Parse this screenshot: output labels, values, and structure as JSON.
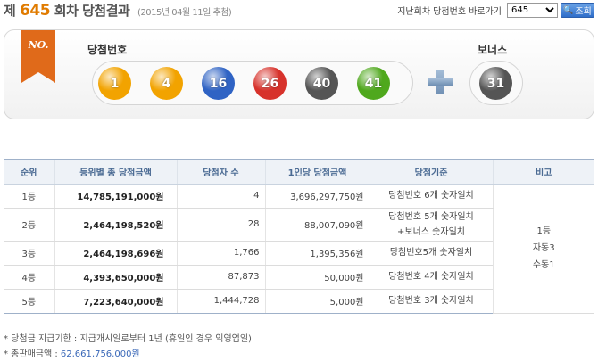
{
  "header": {
    "prefix": "제",
    "round": "645",
    "suffix": "회차 당첨결과",
    "date": "(2015년 04월 11일 추첨)",
    "nav_label": "지난회차 당첨번호 바로가기",
    "selected_round": "645",
    "search_label": "조회",
    "search_icon": "magnifier-icon"
  },
  "result": {
    "badge": "NO.",
    "win_label": "당첨번호",
    "bonus_label": "보너스",
    "numbers": [
      {
        "n": "1",
        "color": "#f2a300"
      },
      {
        "n": "4",
        "color": "#f2a300"
      },
      {
        "n": "16",
        "color": "#2f63c4"
      },
      {
        "n": "26",
        "color": "#d7322b"
      },
      {
        "n": "40",
        "color": "#555555"
      },
      {
        "n": "41",
        "color": "#4fa81d"
      }
    ],
    "bonus": {
      "n": "31",
      "color": "#555555"
    }
  },
  "table": {
    "headers": [
      "순위",
      "등위별 총 당첨금액",
      "당첨자 수",
      "1인당 당첨금액",
      "당첨기준",
      "비고"
    ],
    "rows": [
      {
        "rank": "1등",
        "total": "14,785,191,000원",
        "winners": "4",
        "per": "3,696,297,750원",
        "crit1": "당첨번호 6개 숫자일치",
        "crit2": ""
      },
      {
        "rank": "2등",
        "total": "2,464,198,520원",
        "winners": "28",
        "per": "88,007,090원",
        "crit1": "당첨번호 5개 숫자일치",
        "crit2": "+보너스 숫자일치"
      },
      {
        "rank": "3등",
        "total": "2,464,198,696원",
        "winners": "1,766",
        "per": "1,395,356원",
        "crit1": "당첨번호5개 숫자일치",
        "crit2": ""
      },
      {
        "rank": "4등",
        "total": "4,393,650,000원",
        "winners": "87,873",
        "per": "50,000원",
        "crit1": "당첨번호 4개 숫자일치",
        "crit2": ""
      },
      {
        "rank": "5등",
        "total": "7,223,640,000원",
        "winners": "1,444,728",
        "per": "5,000원",
        "crit1": "당첨번호 3개 숫자일치",
        "crit2": ""
      }
    ],
    "remark": [
      "1등",
      "자동3",
      "수동1"
    ]
  },
  "notes": {
    "payout": "* 당첨금 지급기한 : 지급개시일로부터 1년 (휴일인 경우 익영업일)",
    "sales_label": "* 총판매금액 : ",
    "sales_value": "62,661,756,000원"
  }
}
